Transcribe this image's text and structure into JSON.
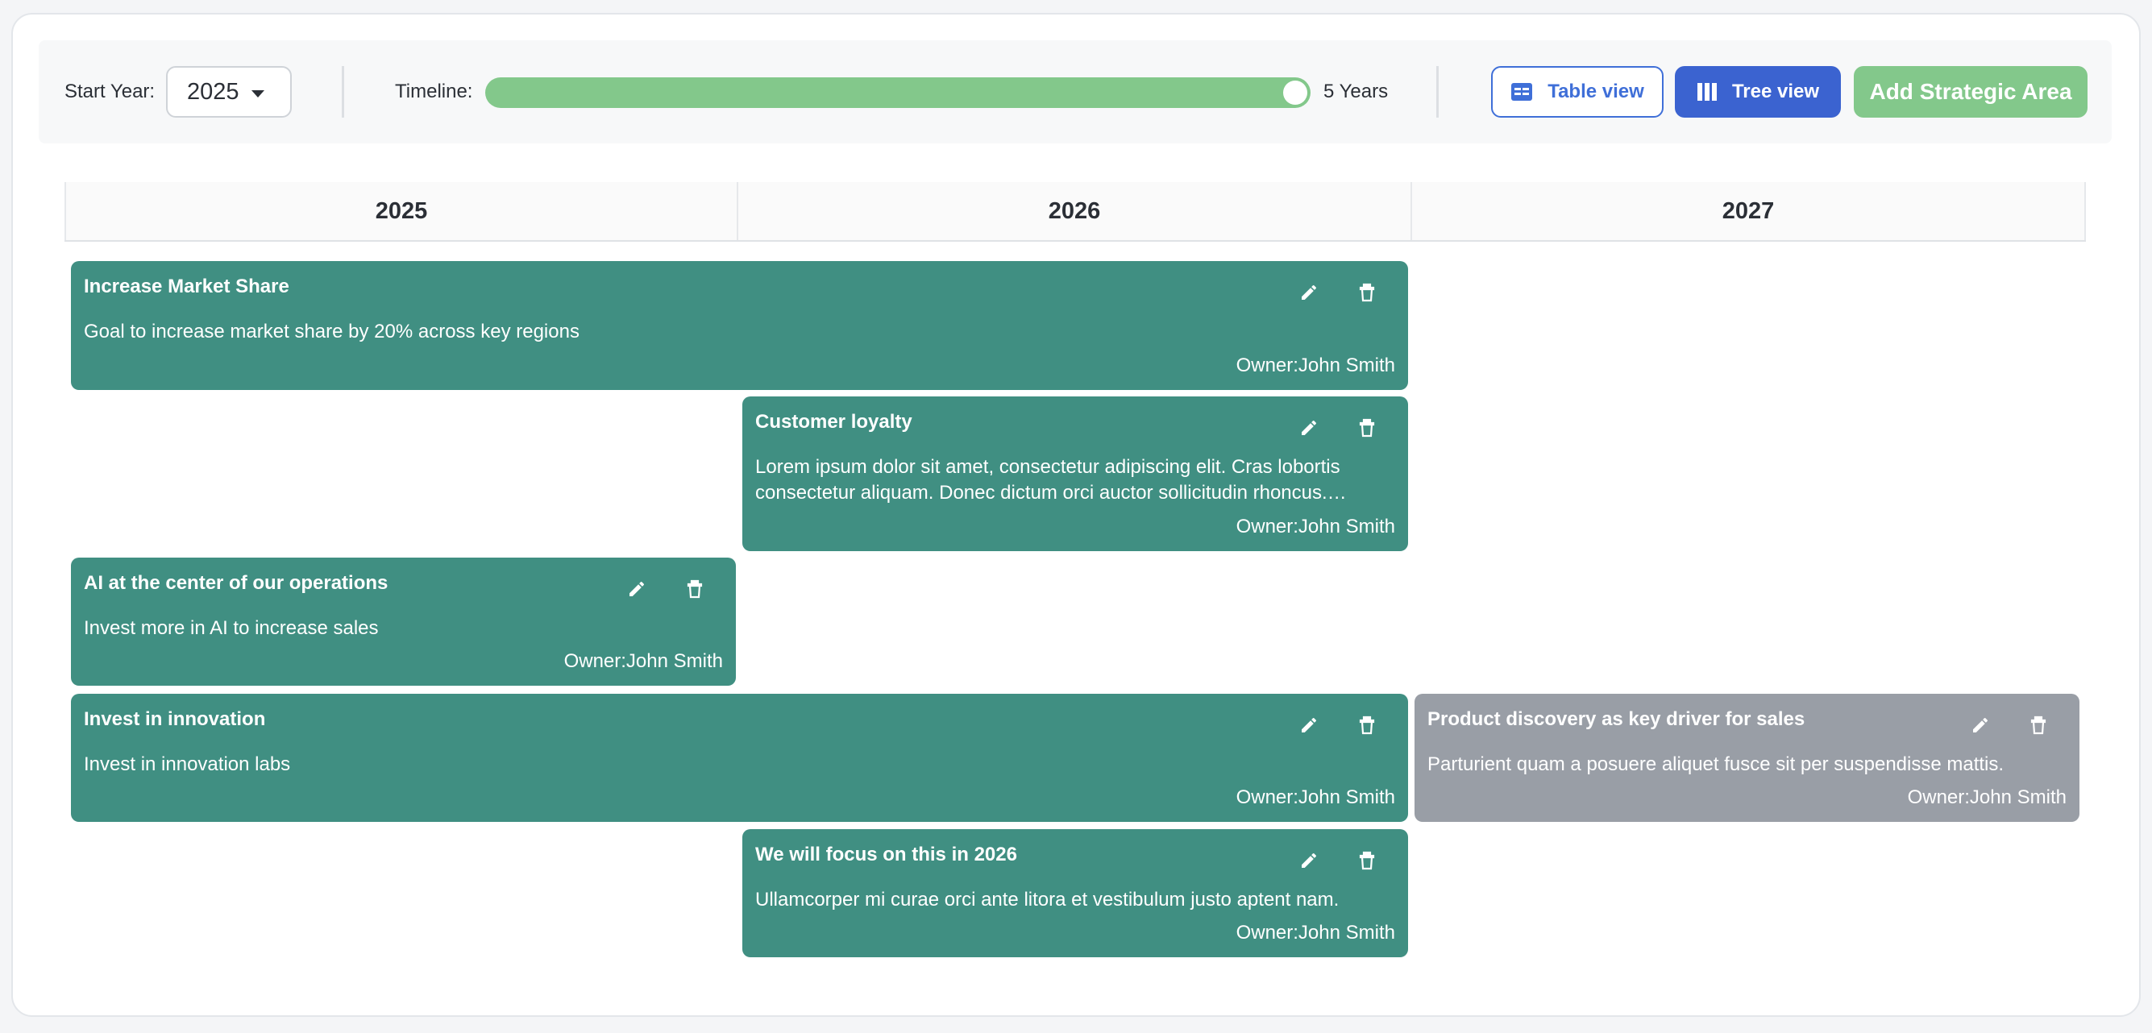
{
  "toolbar": {
    "start_year_label": "Start Year:",
    "start_year_value": "2025",
    "timeline_label": "Timeline:",
    "timeline_value": "5 Years",
    "timeline_fraction": 1.0,
    "table_view_label": "Table view",
    "tree_view_label": "Tree view",
    "add_area_label": "Add Strategic Area"
  },
  "years": [
    "2025",
    "2026",
    "2027"
  ],
  "owner_prefix": "Owner:",
  "goals": [
    {
      "title": "Increase Market Share",
      "description": "Goal to increase market share by 20% across key regions",
      "owner": "Owner:John Smith",
      "status": "active"
    },
    {
      "title": "Customer loyalty",
      "description": "Lorem ipsum dolor sit amet, consectetur adipiscing elit. Cras lobortis consectetur aliquam. Donec dictum orci auctor sollicitudin rhoncus. Quisque facilisis.",
      "owner": "Owner:John Smith",
      "status": "active"
    },
    {
      "title": "AI at the center of our operations",
      "description": "Invest more in AI to increase sales",
      "owner": "Owner:John Smith",
      "status": "active"
    },
    {
      "title": "Invest in innovation",
      "description": "Invest in innovation labs",
      "owner": "Owner:John Smith",
      "status": "active"
    },
    {
      "title": "Product discovery as key driver for sales",
      "description": "Parturient quam a posuere aliquet fusce sit per suspendisse mattis.",
      "owner": "Owner:John Smith",
      "status": "inactive"
    },
    {
      "title": "We will focus on this in 2026",
      "description": "Ullamcorper mi curae orci ante litora et vestibulum justo aptent nam.",
      "owner": "Owner:John Smith",
      "status": "active"
    }
  ],
  "colors": {
    "active": "#408f82",
    "inactive": "#999ea6",
    "accent": "#3b63d0",
    "add": "#83c88b"
  }
}
